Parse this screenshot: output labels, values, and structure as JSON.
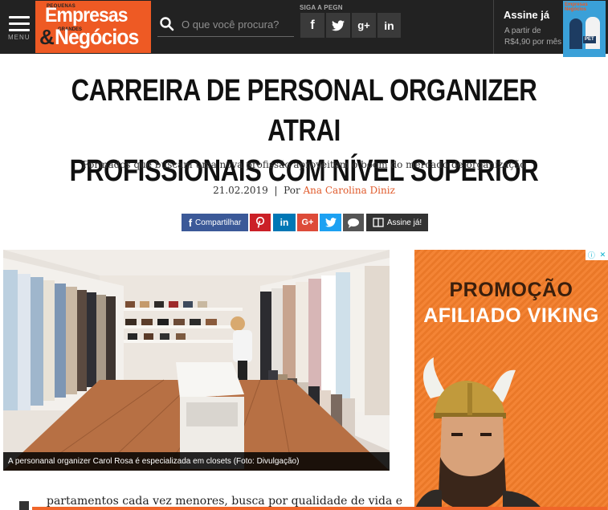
{
  "header": {
    "menu_label": "MENU",
    "logo": {
      "small_top": "PEQUENAS",
      "main_top": "Empresas",
      "amp": "&",
      "small_bottom": "GRANDES",
      "main_bottom": "Negócios"
    },
    "search_placeholder": "O que você procura?",
    "social_label": "SIGA A PEGN",
    "social": [
      "f",
      "t",
      "g+",
      "in"
    ],
    "subscribe": {
      "title": "Assine já",
      "line1": "A partir de",
      "line2": "R$4,90 por mês"
    },
    "magazine_cover_text": [
      "Empresas",
      "Negócios"
    ],
    "magazine_badge": "PET"
  },
  "article": {
    "headline_line1": "CARREIRA DE PERSONAL ORGANIZER ATRAI",
    "headline_line2": "PROFISSIONAIS COM NÍVEL SUPERIOR",
    "subtitle": "Formados que buscam uma nova profissão aproveitam o boom do mercado de organização",
    "date": "21.02.2019",
    "separator": "|",
    "by": "Por",
    "author": "Ana Carolina Diniz",
    "share": {
      "facebook": "Compartilhar",
      "subscribe": "Assine já!"
    },
    "photo_caption": "A personanal organizer Carol Rosa é especializada em closets (Foto: Divulgação)",
    "body_start": "partamentos cada vez menores, busca por qualidade de vida e"
  },
  "ad": {
    "line1": "PROMOÇÃO",
    "line2": "AFILIADO VIKING"
  },
  "colors": {
    "header_bg": "#222222",
    "brand_orange": "#ee5a24",
    "author_link": "#e05a2b",
    "ad_orange": "#f37d2a",
    "facebook": "#3b5998",
    "pinterest": "#cb2027",
    "linkedin": "#0077b5",
    "googleplus": "#dd4b39",
    "twitter": "#1da1f2"
  }
}
